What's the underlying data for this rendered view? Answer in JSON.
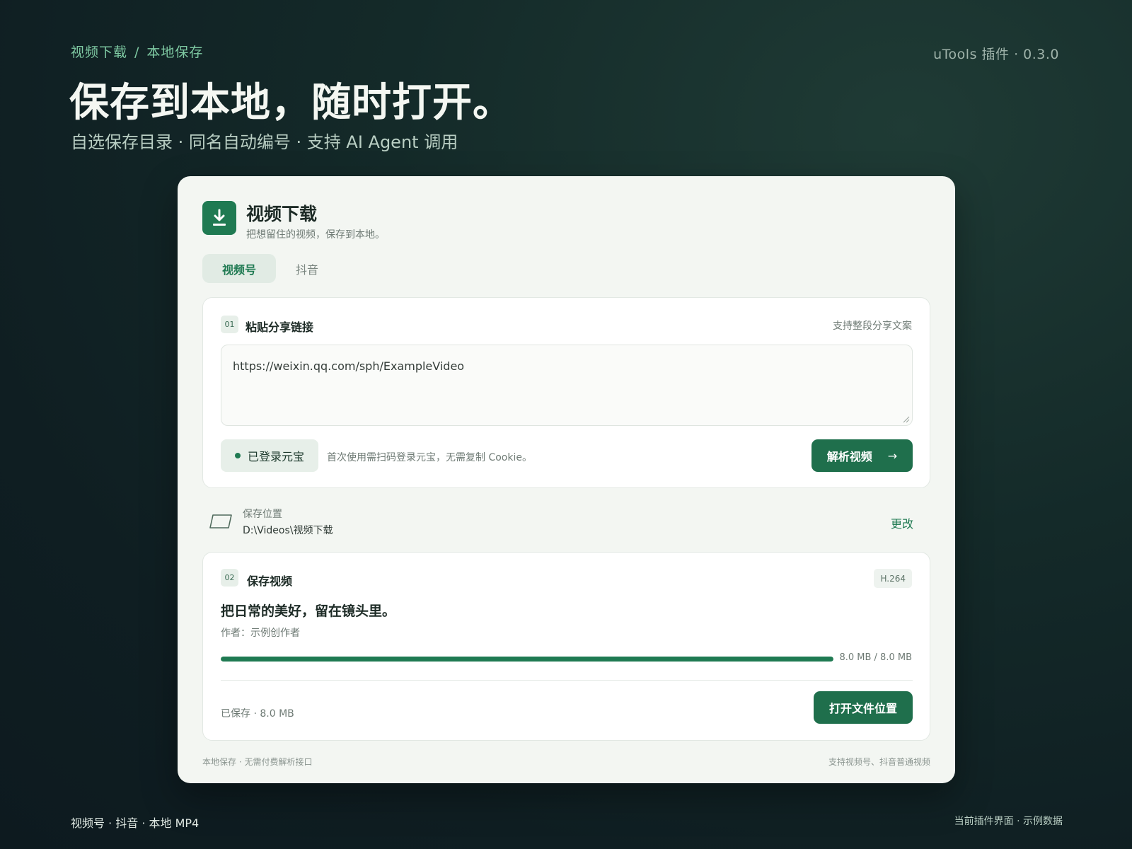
{
  "header": {
    "breadcrumb": [
      "视频下载",
      "本地保存"
    ],
    "breadcrumb_sep": "/",
    "version": "uTools 插件 · 0.3.0",
    "title": "保存到本地，随时打开。",
    "subtitle": "自选保存目录 · 同名自动编号 · 支持 AI Agent 调用"
  },
  "app": {
    "icon": "download-icon",
    "title": "视频下载",
    "subtitle": "把想留住的视频，保存到本地。",
    "accent": "#1f7a52",
    "tabs": [
      {
        "label": "视频号",
        "active": true
      },
      {
        "label": "抖音",
        "active": false
      }
    ]
  },
  "step1": {
    "no": "01",
    "title": "粘贴分享链接",
    "hint": "支持整段分享文案",
    "url_value": "https://weixin.qq.com/sph/ExampleVideo",
    "login_badge": "已登录元宝",
    "login_note": "首次使用需扫码登录元宝，无需复制 Cookie。",
    "parse_button": "解析视频",
    "parse_arrow": "→"
  },
  "save_location": {
    "icon": "folder-icon",
    "label": "保存位置",
    "path": "D:\\Videos\\视频下载",
    "change": "更改"
  },
  "step2": {
    "no": "02",
    "title": "保存视频",
    "codec": "H.264",
    "video_title": "把日常的美好，留在镜头里。",
    "author": "作者：示例创作者",
    "progress": 1.0,
    "progress_text": "8.0 MB / 8.0 MB",
    "saved_text": "已保存 · 8.0 MB",
    "open_button": "打开文件位置"
  },
  "card_footer": {
    "left": "本地保存 · 无需付费解析接口",
    "right": "支持视频号、抖音普通视频"
  },
  "page_footer": {
    "left": "视频号 · 抖音 · 本地 MP4",
    "right": "当前插件界面 · 示例数据"
  }
}
